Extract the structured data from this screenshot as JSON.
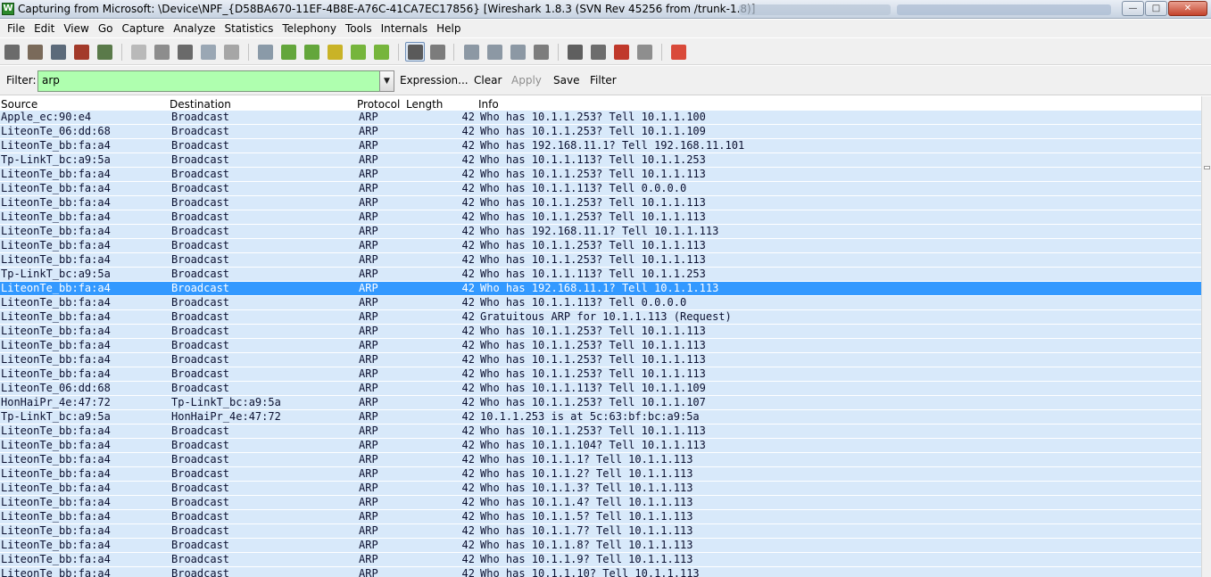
{
  "window": {
    "title": "Capturing from Microsoft: \\Device\\NPF_{D58BA670-11EF-4B8E-A76C-41CA7EC17856}   [Wireshark 1.8.3  (SVN Rev 45256 from /trunk-1.8)]",
    "app_icon": "wireshark-icon",
    "controls": [
      "minimize-icon",
      "maximize-icon",
      "close-icon"
    ]
  },
  "menu": [
    {
      "label": "File"
    },
    {
      "label": "Edit"
    },
    {
      "label": "View"
    },
    {
      "label": "Go"
    },
    {
      "label": "Capture"
    },
    {
      "label": "Analyze"
    },
    {
      "label": "Statistics"
    },
    {
      "label": "Telephony"
    },
    {
      "label": "Tools"
    },
    {
      "label": "Internals"
    },
    {
      "label": "Help"
    }
  ],
  "filter": {
    "label": "Filter:",
    "value": "arp",
    "expression_label": "Expression...",
    "clear_label": "Clear",
    "apply_label": "Apply",
    "save_label": "Save",
    "filter_label": "Filter",
    "valid_color": "#afffaf"
  },
  "columns": {
    "source": "Source",
    "destination": "Destination",
    "protocol": "Protocol",
    "length": "Length",
    "info": "Info"
  },
  "colors": {
    "row_background": "#d8e9fa",
    "selected_row": "#3399ff"
  },
  "packets": [
    {
      "source": "Apple_ec:90:e4",
      "destination": "Broadcast",
      "protocol": "ARP",
      "length": "42",
      "info": "Who has 10.1.1.253?  Tell 10.1.1.100"
    },
    {
      "source": "LiteonTe_06:dd:68",
      "destination": "Broadcast",
      "protocol": "ARP",
      "length": "42",
      "info": "Who has 10.1.1.253?  Tell 10.1.1.109"
    },
    {
      "source": "LiteonTe_bb:fa:a4",
      "destination": "Broadcast",
      "protocol": "ARP",
      "length": "42",
      "info": "Who has 192.168.11.1?  Tell 192.168.11.101"
    },
    {
      "source": "Tp-LinkT_bc:a9:5a",
      "destination": "Broadcast",
      "protocol": "ARP",
      "length": "42",
      "info": "Who has 10.1.1.113?  Tell 10.1.1.253"
    },
    {
      "source": "LiteonTe_bb:fa:a4",
      "destination": "Broadcast",
      "protocol": "ARP",
      "length": "42",
      "info": "Who has 10.1.1.253?  Tell 10.1.1.113"
    },
    {
      "source": "LiteonTe_bb:fa:a4",
      "destination": "Broadcast",
      "protocol": "ARP",
      "length": "42",
      "info": "Who has 10.1.1.113?  Tell 0.0.0.0"
    },
    {
      "source": "LiteonTe_bb:fa:a4",
      "destination": "Broadcast",
      "protocol": "ARP",
      "length": "42",
      "info": "Who has 10.1.1.253?  Tell 10.1.1.113"
    },
    {
      "source": "LiteonTe_bb:fa:a4",
      "destination": "Broadcast",
      "protocol": "ARP",
      "length": "42",
      "info": "Who has 10.1.1.253?  Tell 10.1.1.113"
    },
    {
      "source": "LiteonTe_bb:fa:a4",
      "destination": "Broadcast",
      "protocol": "ARP",
      "length": "42",
      "info": "Who has 192.168.11.1?  Tell 10.1.1.113"
    },
    {
      "source": "LiteonTe_bb:fa:a4",
      "destination": "Broadcast",
      "protocol": "ARP",
      "length": "42",
      "info": "Who has 10.1.1.253?  Tell 10.1.1.113"
    },
    {
      "source": "LiteonTe_bb:fa:a4",
      "destination": "Broadcast",
      "protocol": "ARP",
      "length": "42",
      "info": "Who has 10.1.1.253?  Tell 10.1.1.113"
    },
    {
      "source": "Tp-LinkT_bc:a9:5a",
      "destination": "Broadcast",
      "protocol": "ARP",
      "length": "42",
      "info": "Who has 10.1.1.113?  Tell 10.1.1.253"
    },
    {
      "source": "LiteonTe_bb:fa:a4",
      "destination": "Broadcast",
      "protocol": "ARP",
      "length": "42",
      "info": "Who has 192.168.11.1?  Tell 10.1.1.113",
      "selected": true
    },
    {
      "source": "LiteonTe_bb:fa:a4",
      "destination": "Broadcast",
      "protocol": "ARP",
      "length": "42",
      "info": "Who has 10.1.1.113?  Tell 0.0.0.0"
    },
    {
      "source": "LiteonTe_bb:fa:a4",
      "destination": "Broadcast",
      "protocol": "ARP",
      "length": "42",
      "info": "Gratuitous ARP for 10.1.1.113 (Request)"
    },
    {
      "source": "LiteonTe_bb:fa:a4",
      "destination": "Broadcast",
      "protocol": "ARP",
      "length": "42",
      "info": "Who has 10.1.1.253?  Tell 10.1.1.113"
    },
    {
      "source": "LiteonTe_bb:fa:a4",
      "destination": "Broadcast",
      "protocol": "ARP",
      "length": "42",
      "info": "Who has 10.1.1.253?  Tell 10.1.1.113"
    },
    {
      "source": "LiteonTe_bb:fa:a4",
      "destination": "Broadcast",
      "protocol": "ARP",
      "length": "42",
      "info": "Who has 10.1.1.253?  Tell 10.1.1.113"
    },
    {
      "source": "LiteonTe_bb:fa:a4",
      "destination": "Broadcast",
      "protocol": "ARP",
      "length": "42",
      "info": "Who has 10.1.1.253?  Tell 10.1.1.113"
    },
    {
      "source": "LiteonTe_06:dd:68",
      "destination": "Broadcast",
      "protocol": "ARP",
      "length": "42",
      "info": "Who has 10.1.1.113?  Tell 10.1.1.109"
    },
    {
      "source": "HonHaiPr_4e:47:72",
      "destination": "Tp-LinkT_bc:a9:5a",
      "protocol": "ARP",
      "length": "42",
      "info": "Who has 10.1.1.253?  Tell 10.1.1.107"
    },
    {
      "source": "Tp-LinkT_bc:a9:5a",
      "destination": "HonHaiPr_4e:47:72",
      "protocol": "ARP",
      "length": "42",
      "info": "10.1.1.253 is at 5c:63:bf:bc:a9:5a"
    },
    {
      "source": "LiteonTe_bb:fa:a4",
      "destination": "Broadcast",
      "protocol": "ARP",
      "length": "42",
      "info": "Who has 10.1.1.253?  Tell 10.1.1.113"
    },
    {
      "source": "LiteonTe_bb:fa:a4",
      "destination": "Broadcast",
      "protocol": "ARP",
      "length": "42",
      "info": "Who has 10.1.1.104?  Tell 10.1.1.113"
    },
    {
      "source": "LiteonTe_bb:fa:a4",
      "destination": "Broadcast",
      "protocol": "ARP",
      "length": "42",
      "info": "Who has 10.1.1.1?  Tell 10.1.1.113"
    },
    {
      "source": "LiteonTe_bb:fa:a4",
      "destination": "Broadcast",
      "protocol": "ARP",
      "length": "42",
      "info": "Who has 10.1.1.2?  Tell 10.1.1.113"
    },
    {
      "source": "LiteonTe_bb:fa:a4",
      "destination": "Broadcast",
      "protocol": "ARP",
      "length": "42",
      "info": "Who has 10.1.1.3?  Tell 10.1.1.113"
    },
    {
      "source": "LiteonTe_bb:fa:a4",
      "destination": "Broadcast",
      "protocol": "ARP",
      "length": "42",
      "info": "Who has 10.1.1.4?  Tell 10.1.1.113"
    },
    {
      "source": "LiteonTe_bb:fa:a4",
      "destination": "Broadcast",
      "protocol": "ARP",
      "length": "42",
      "info": "Who has 10.1.1.5?  Tell 10.1.1.113"
    },
    {
      "source": "LiteonTe_bb:fa:a4",
      "destination": "Broadcast",
      "protocol": "ARP",
      "length": "42",
      "info": "Who has 10.1.1.7?  Tell 10.1.1.113"
    },
    {
      "source": "LiteonTe_bb:fa:a4",
      "destination": "Broadcast",
      "protocol": "ARP",
      "length": "42",
      "info": "Who has 10.1.1.8?  Tell 10.1.1.113"
    },
    {
      "source": "LiteonTe_bb:fa:a4",
      "destination": "Broadcast",
      "protocol": "ARP",
      "length": "42",
      "info": "Who has 10.1.1.9?  Tell 10.1.1.113"
    },
    {
      "source": "LiteonTe_bb:fa:a4",
      "destination": "Broadcast",
      "protocol": "ARP",
      "length": "42",
      "info": "Who has 10.1.1.10?  Tell 10.1.1.113"
    }
  ]
}
